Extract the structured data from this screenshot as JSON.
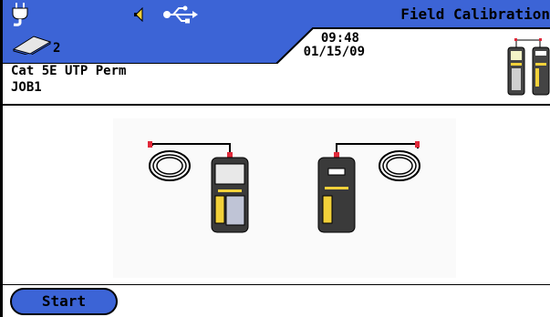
{
  "header": {
    "title": "Field Calibration",
    "time": "09:48",
    "date": "01/15/09",
    "tray_count": "2"
  },
  "test": {
    "cable_type": "Cat 5E UTP Perm",
    "job": "JOB1"
  },
  "footer": {
    "start_label": "Start"
  },
  "icons": [
    "power-plug-icon",
    "speaker-icon",
    "usb-icon",
    "tray-icon",
    "tester-pair-icon",
    "cable-coil-icon",
    "handheld-tester-icon"
  ],
  "colors": {
    "accent": "#3c64d6",
    "connector_red": "#e0293a",
    "tester_yellow": "#f2d13a"
  }
}
